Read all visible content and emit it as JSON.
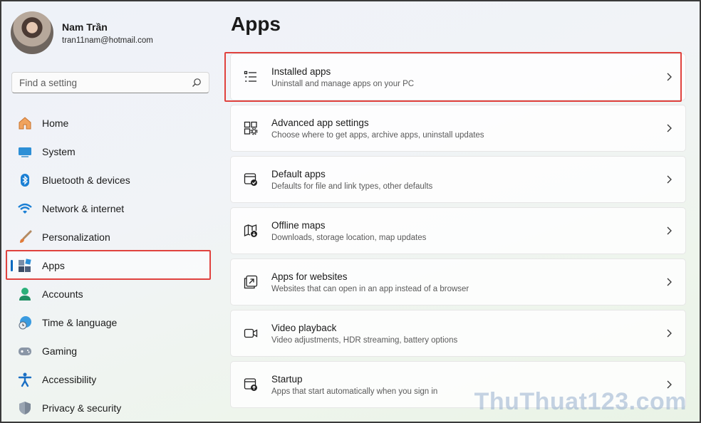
{
  "profile": {
    "name": "Nam Trần",
    "email": "tran11nam@hotmail.com"
  },
  "search": {
    "placeholder": "Find a setting"
  },
  "sidebar": {
    "items": [
      {
        "label": "Home",
        "icon": "home-icon"
      },
      {
        "label": "System",
        "icon": "monitor-icon"
      },
      {
        "label": "Bluetooth & devices",
        "icon": "bluetooth-icon"
      },
      {
        "label": "Network & internet",
        "icon": "wifi-icon"
      },
      {
        "label": "Personalization",
        "icon": "brush-icon"
      },
      {
        "label": "Apps",
        "icon": "apps-icon",
        "active": true
      },
      {
        "label": "Accounts",
        "icon": "person-icon"
      },
      {
        "label": "Time & language",
        "icon": "globe-clock-icon"
      },
      {
        "label": "Gaming",
        "icon": "gamepad-icon"
      },
      {
        "label": "Accessibility",
        "icon": "accessibility-icon"
      },
      {
        "label": "Privacy & security",
        "icon": "shield-icon"
      }
    ]
  },
  "main": {
    "title": "Apps",
    "cards": [
      {
        "title": "Installed apps",
        "desc": "Uninstall and manage apps on your PC",
        "icon": "list-icon"
      },
      {
        "title": "Advanced app settings",
        "desc": "Choose where to get apps, archive apps, uninstall updates",
        "icon": "app-settings-icon"
      },
      {
        "title": "Default apps",
        "desc": "Defaults for file and link types, other defaults",
        "icon": "default-apps-icon"
      },
      {
        "title": "Offline maps",
        "desc": "Downloads, storage location, map updates",
        "icon": "map-icon"
      },
      {
        "title": "Apps for websites",
        "desc": "Websites that can open in an app instead of a browser",
        "icon": "open-external-icon"
      },
      {
        "title": "Video playback",
        "desc": "Video adjustments, HDR streaming, battery options",
        "icon": "video-icon"
      },
      {
        "title": "Startup",
        "desc": "Apps that start automatically when you sign in",
        "icon": "startup-icon"
      }
    ]
  },
  "watermark": "ThuThuat123.com",
  "colors": {
    "accent": "#0067c0",
    "highlight": "#e0423e"
  }
}
